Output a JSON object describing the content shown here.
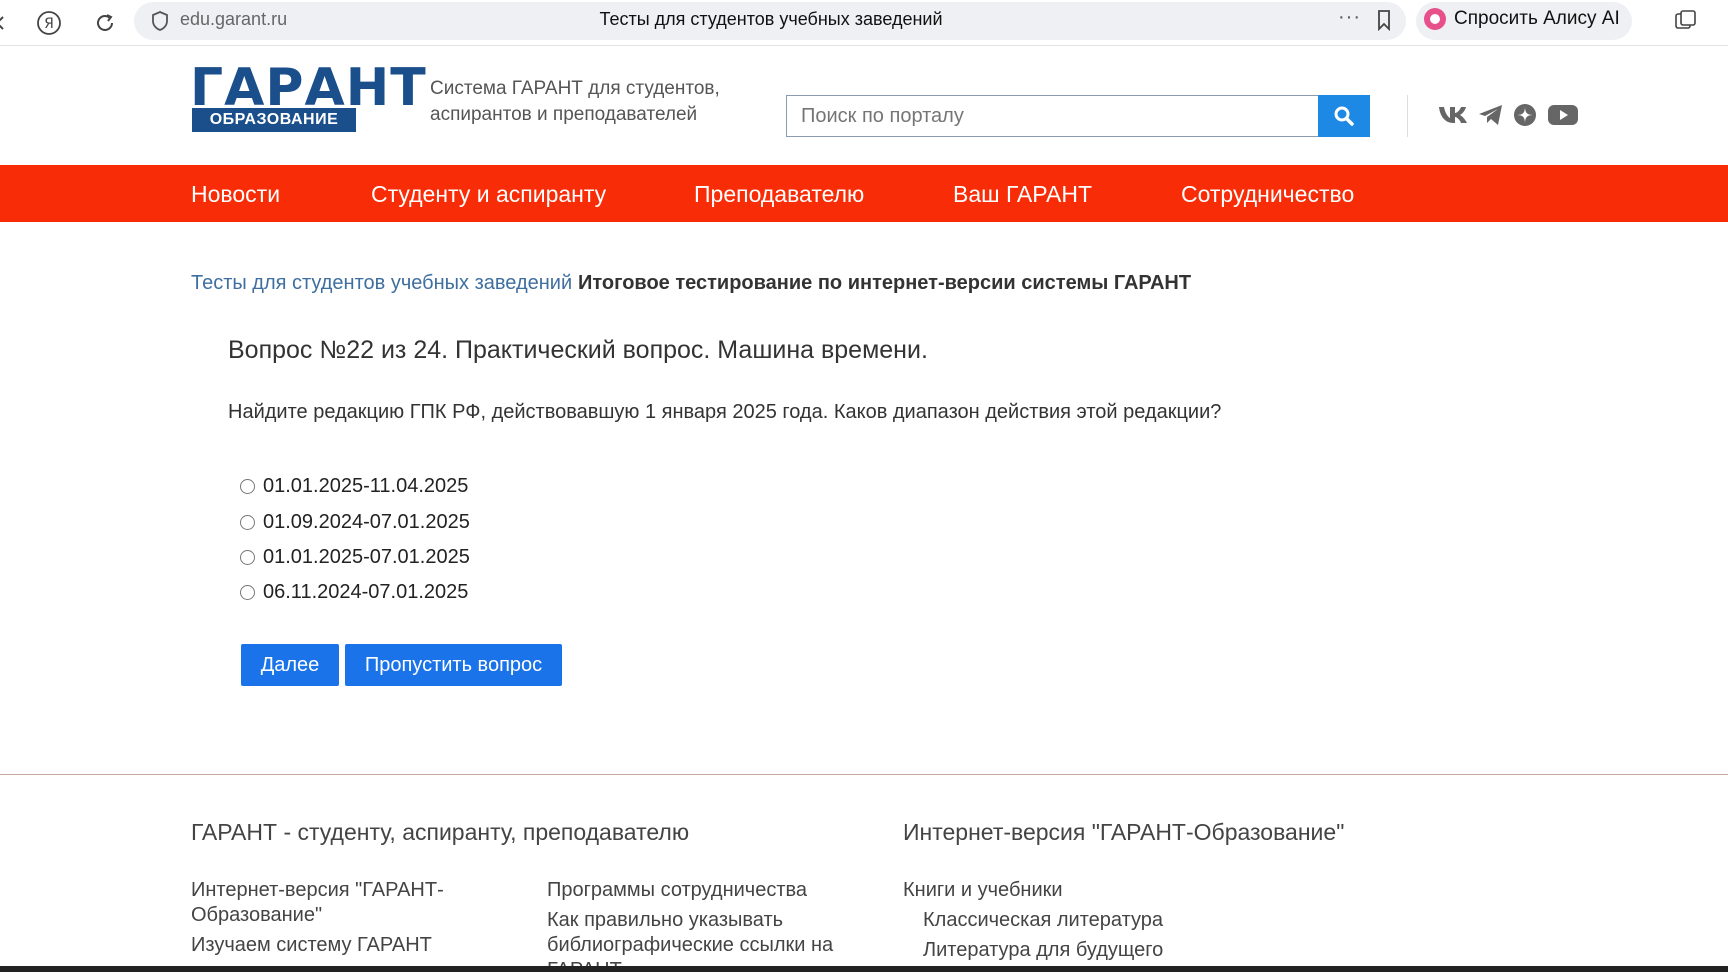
{
  "browser": {
    "url": "edu.garant.ru",
    "tab_title": "Тесты для студентов учебных заведений",
    "alice_label": "Спросить Алису AI",
    "yandex_glyph": "Я"
  },
  "header": {
    "logo_main": "ГАРАНТ",
    "logo_sub": "ОБРАЗОВАНИЕ",
    "tagline": "Система ГАРАНТ для студентов, аспирантов и преподавателей",
    "search_placeholder": "Поиск по порталу",
    "social_icons": [
      "vk-icon",
      "telegram-icon",
      "dzen-icon",
      "youtube-icon"
    ]
  },
  "nav": {
    "items": [
      "Новости",
      "Студенту и аспиранту",
      "Преподавателю",
      "Ваш ГАРАНТ",
      "Сотрудничество"
    ]
  },
  "breadcrumb": {
    "link": "Тесты для студентов учебных заведений",
    "current": "Итоговое тестирование по интернет-версии системы ГАРАНТ"
  },
  "question": {
    "title": "Вопрос №22 из 24. Практический вопрос. Машина времени.",
    "text": "Найдите редакцию ГПК РФ, действовавшую 1 января 2025 года. Каков диапазон действия этой редакции?",
    "options": [
      "01.01.2025-11.04.2025",
      "01.09.2024-07.01.2025",
      "01.01.2025-07.01.2025",
      "06.11.2024-07.01.2025"
    ],
    "next_label": "Далее",
    "skip_label": "Пропустить вопрос"
  },
  "footer": {
    "col1_title": "ГАРАНТ - студенту, аспиранту, преподавателю",
    "col1_links": [
      "Интернет-версия \"ГАРАНТ-Образование\"",
      "Изучаем систему ГАРАНТ"
    ],
    "col2_links": [
      "Программы сотрудничества",
      "Как правильно указывать библиографические ссылки на ГАРАНТ"
    ],
    "col3_title": "Интернет-версия \"ГАРАНТ-Образование\"",
    "col3_links": [
      "Книги и учебники",
      "Классическая литература",
      "Литература для будущего"
    ]
  },
  "colors": {
    "nav_bg": "#f82c06",
    "brand_blue": "#1a4f8b",
    "button_blue": "#1a73e8",
    "search_blue": "#1e88e5"
  }
}
